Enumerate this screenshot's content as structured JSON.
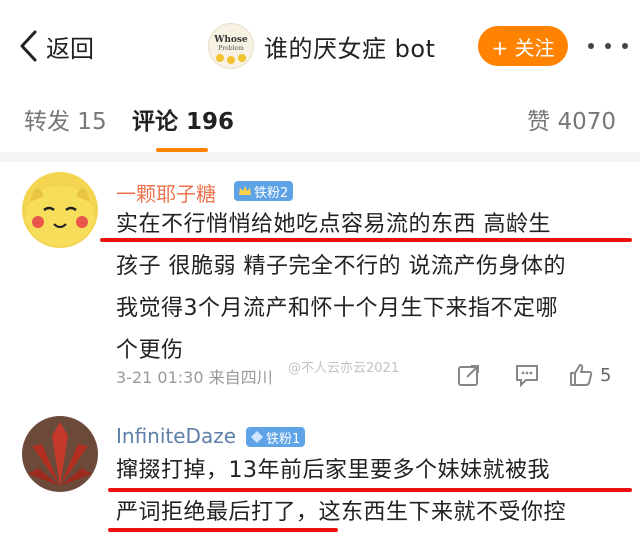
{
  "header": {
    "back_label": "返回",
    "avatar_text": "Whose",
    "avatar_subtext": "Problem",
    "title": "谁的厌女症 bot",
    "follow_label": "+ 关注"
  },
  "tabs": {
    "repost": "转发 15",
    "comment": "评论 196",
    "like": "赞 4070"
  },
  "comments": [
    {
      "username": "一颗耶子糖",
      "badge": "铁粉2",
      "lines": [
        "实在不行悄悄给她吃点容易流的东西 高龄生",
        "孩子 很脆弱 精子完全不行的 说流产伤身体的",
        "我觉得3个月流产和怀十个月生下来指不定哪",
        "个更伤"
      ],
      "meta": "3-21 01:30  来自四川",
      "likes": "5"
    },
    {
      "username": "InfiniteDaze",
      "badge": "铁粉1",
      "lines": [
        "撺掇打掉，13年前后家里要多个妹妹就被我",
        "严词拒绝最后打了，这东西生下来就不受你控"
      ]
    }
  ],
  "watermark": "@不人云亦云2021",
  "colors": {
    "accent": "#ff8200",
    "username": "#eb7350",
    "badge": "#5ea3e6",
    "highlight_line": "#e11"
  }
}
